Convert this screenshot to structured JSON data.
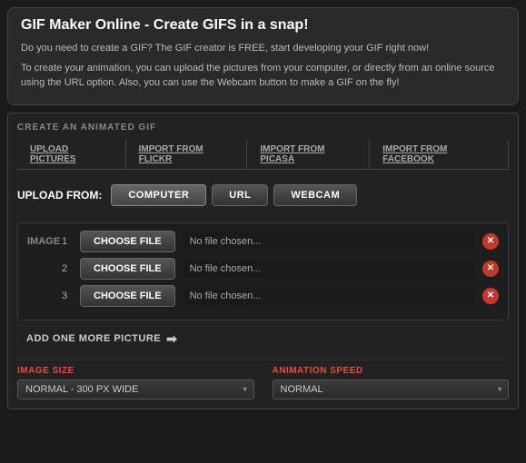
{
  "header": {
    "title": "GIF Maker Online - Create GIFS in a snap!",
    "description1": "Do you need to create a GIF? The GIF creator is FREE, start developing your GIF right now!",
    "description2": "To create your animation, you can upload the pictures from your computer, or directly from an online source using the URL option. Also, you can use the Webcam button to make a GIF on the fly!"
  },
  "section": {
    "title": "CREATE AN ANIMATED GIF",
    "tabs": [
      {
        "label": "UPLOAD PICTURES"
      },
      {
        "label": "IMPORT FROM FLICKR"
      },
      {
        "label": "IMPORT FROM PICASA"
      },
      {
        "label": "IMPORT FROM FACEBOOK"
      }
    ],
    "upload_from_label": "UPLOAD FROM:",
    "source_buttons": [
      {
        "label": "COMPUTER",
        "active": true
      },
      {
        "label": "URL",
        "active": false
      },
      {
        "label": "WEBCAM",
        "active": false
      }
    ],
    "image_label": "IMAGE",
    "images": [
      {
        "number": "1",
        "placeholder": "No file chosen..."
      },
      {
        "number": "2",
        "placeholder": "No file chosen..."
      },
      {
        "number": "3",
        "placeholder": "No file chosen..."
      }
    ],
    "choose_file_label": "CHOOSE FILE",
    "add_more_label": "ADD ONE MORE PICTURE",
    "arrow": "➡",
    "image_size": {
      "label": "IMAGE",
      "label_colored": "SIZE",
      "value": "NORMAL - 300 PX WIDE"
    },
    "animation_speed": {
      "label": "ANIMATION",
      "label_colored": "SPEED",
      "value": "NORMAL"
    }
  }
}
